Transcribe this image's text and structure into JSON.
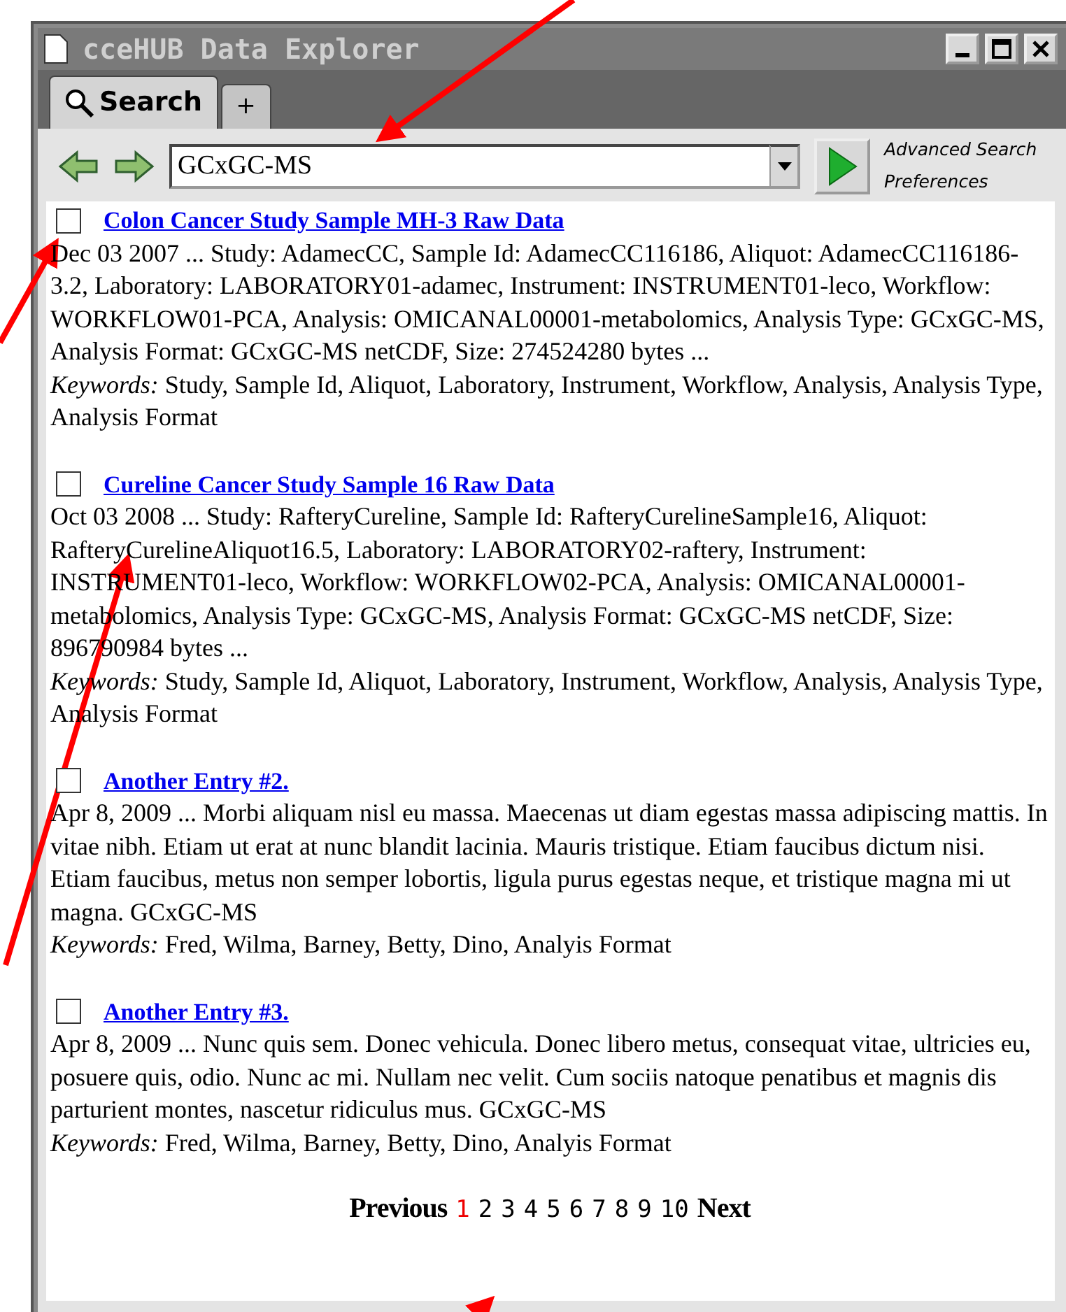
{
  "window": {
    "title": "cceHUB Data Explorer"
  },
  "tabs": [
    {
      "label": "Search",
      "selected": true,
      "kind": "search"
    },
    {
      "label": "+",
      "selected": false,
      "kind": "add"
    }
  ],
  "search": {
    "value": "GCxGC-MS"
  },
  "links": [
    "Advanced Search",
    "Preferences"
  ],
  "results": [
    {
      "title": "Colon Cancer Study Sample MH-3 Raw Data",
      "checked": false,
      "summary": "Dec 03 2007 ... Study: AdamecCC, Sample Id: AdamecCC116186, Aliquot: AdamecCC116186-3.2, Laboratory: LABORATORY01-adamec, Instrument: INSTRUMENT01-leco, Workflow: WORKFLOW01-PCA, Analysis: OMICANAL00001-metabolomics, Analysis Type: GCxGC-MS, Analysis Format: GCxGC-MS netCDF, Size: 274524280 bytes ...",
      "keywords": "*Keywords:*  Study, Sample Id, Aliquot, Laboratory, Instrument, Workflow, Analysis, Analysis Type, Analysis Format"
    },
    {
      "title": "Cureline Cancer Study Sample 16 Raw Data",
      "checked": false,
      "summary": "Oct 03 2008 ... Study: RafteryCureline, Sample Id: RafteryCurelineSample16, Aliquot: RafteryCurelineAliquot16.5, Laboratory: LABORATORY02-raftery, Instrument: INSTRUMENT01-leco, Workflow: WORKFLOW02-PCA, Analysis: OMICANAL00001-metabolomics, Analysis Type: GCxGC-MS, Analysis Format: GCxGC-MS netCDF, Size: 896790984 bytes ...",
      "keywords": "*Keywords:*  Study, Sample Id, Aliquot, Laboratory, Instrument, Workflow, Analysis, Analysis Type, Analysis Format"
    },
    {
      "title": "Another Entry #2.",
      "checked": false,
      "summary": "Apr  8, 2009 ... Morbi aliquam nisl eu massa. Maecenas ut diam egestas massa adipiscing mattis. In vitae nibh. Etiam ut erat at nunc blandit lacinia. Mauris tristique. Etiam faucibus dictum nisi. Etiam faucibus, metus non semper lobortis, ligula purus egestas neque, et tristique magna mi ut magna.  GCxGC-MS",
      "keywords": "*Keywords:*  Fred, Wilma, Barney, Betty, Dino, Analyis Format"
    },
    {
      "title": "Another Entry #3.",
      "checked": false,
      "summary": "Apr  8, 2009 ... Nunc quis sem. Donec vehicula. Donec libero metus, consequat vitae, ultricies eu, posuere quis, odio. Nunc ac mi. Nullam nec velit. Cum sociis natoque penatibus et magnis dis parturient montes, nascetur ridiculus mus.  GCxGC-MS",
      "keywords": "*Keywords:*  Fred, Wilma, Barney, Betty, Dino, Analyis Format"
    }
  ],
  "pagination": {
    "previous": "Previous",
    "next": "Next",
    "pages": [
      {
        "label": "1",
        "selected": true
      },
      {
        "label": "2",
        "selected": false
      },
      {
        "label": "3",
        "selected": false
      },
      {
        "label": "4",
        "selected": false
      },
      {
        "label": "5",
        "selected": false
      },
      {
        "label": "6",
        "selected": false
      },
      {
        "label": "7",
        "selected": false
      },
      {
        "label": "8",
        "selected": false
      },
      {
        "label": "9",
        "selected": false
      },
      {
        "label": "10",
        "selected": false
      }
    ]
  }
}
